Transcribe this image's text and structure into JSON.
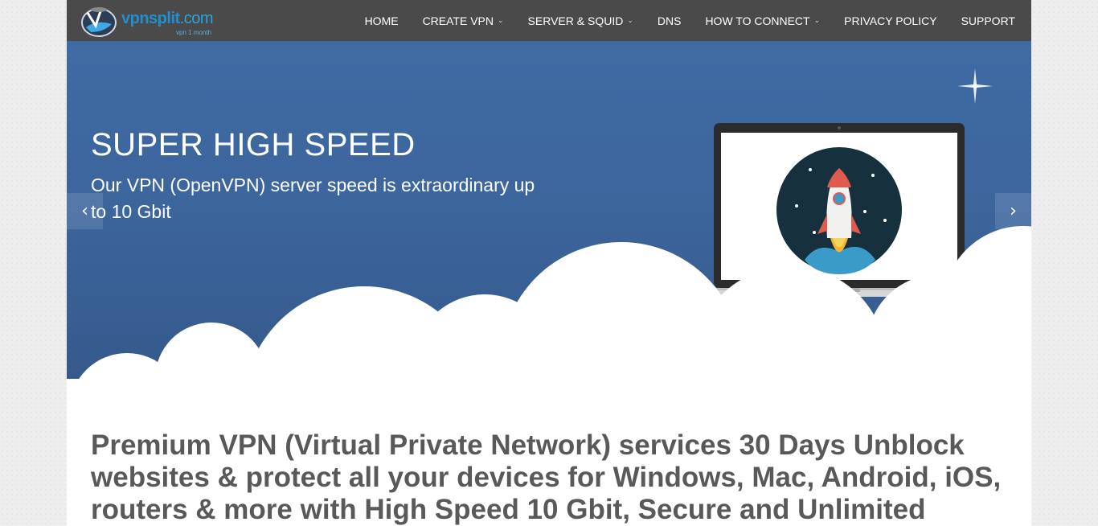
{
  "brand": {
    "name_main": "vpnsplit",
    "name_domain": ".com",
    "tagline": "vpn 1 month",
    "accent": "#1f8fd0"
  },
  "nav": {
    "items": [
      {
        "label": "HOME",
        "has_dropdown": false
      },
      {
        "label": "CREATE VPN",
        "has_dropdown": true
      },
      {
        "label": "SERVER & SQUID",
        "has_dropdown": true
      },
      {
        "label": "DNS",
        "has_dropdown": false
      },
      {
        "label": "HOW TO CONNECT",
        "has_dropdown": true
      },
      {
        "label": "PRIVACY POLICY",
        "has_dropdown": false
      },
      {
        "label": "SUPPORT",
        "has_dropdown": false
      }
    ],
    "dropdown_icon": "chevron-down-icon"
  },
  "hero": {
    "title": "SUPER HIGH SPEED",
    "subtitle": "Our VPN (OpenVPN) server speed is extraordinary up to 10 Gbit",
    "prev_icon": "chevron-left-icon",
    "next_icon": "chevron-right-icon",
    "prev_glyph": "‹",
    "next_glyph": "›",
    "background_color": "#3c659c"
  },
  "main": {
    "headline": "Premium VPN (Virtual Private Network) services 30 Days Unblock websites & protect all your devices for Windows, Mac, Android, iOS, routers & more with High Speed 10 Gbit, Secure and Unlimited"
  }
}
